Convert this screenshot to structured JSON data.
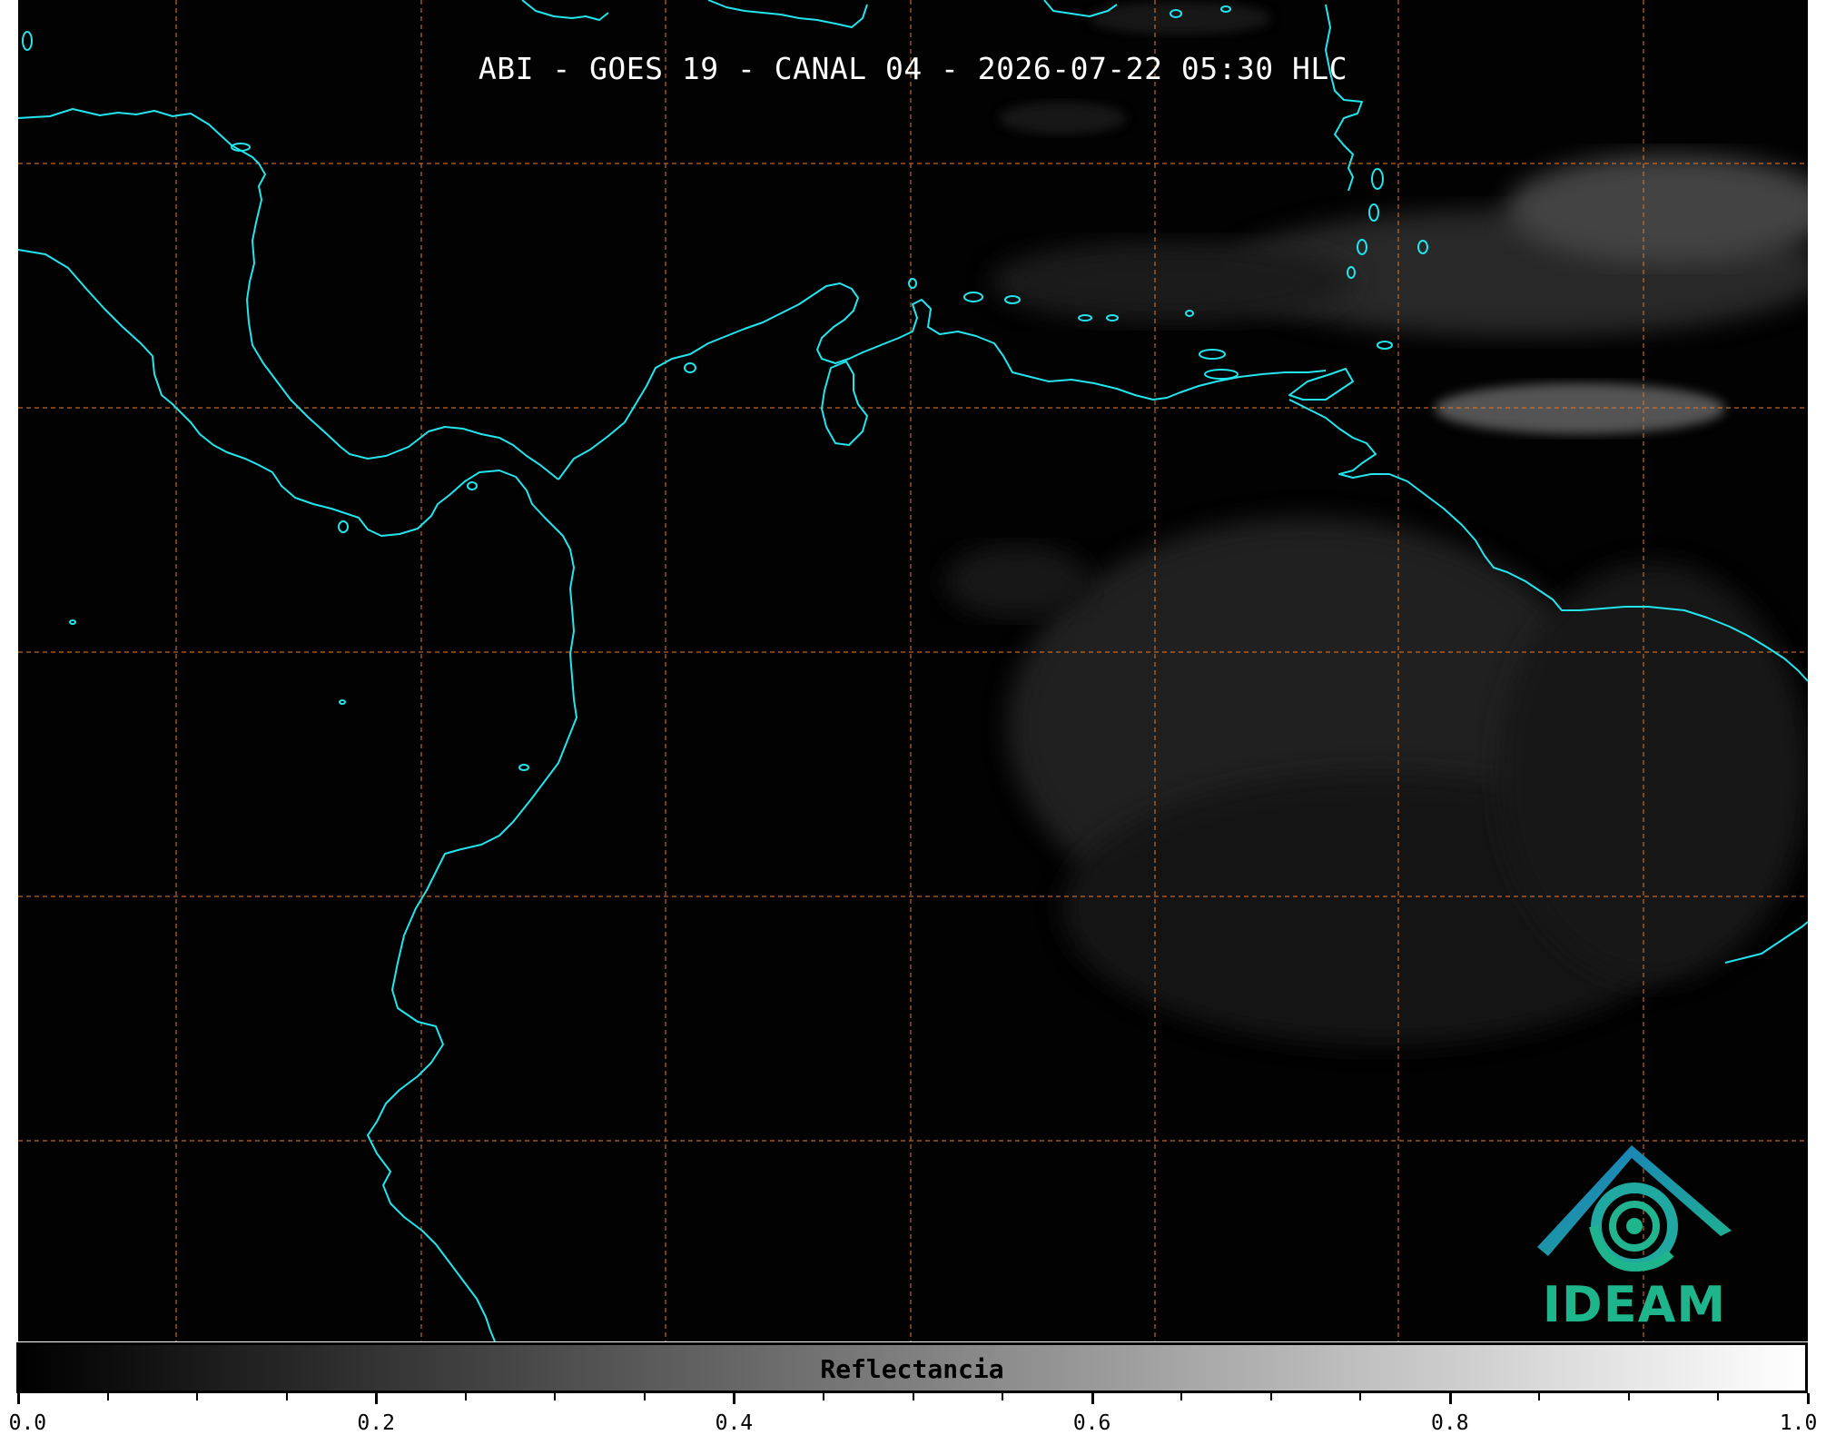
{
  "title": "ABI - GOES 19 - CANAL 04 - 2026-07-22 05:30 HLC",
  "colorbar": {
    "label": "Reflectancia",
    "range": [
      0.0,
      1.0
    ],
    "colormap": "grayscale",
    "major_ticks": [
      "0.0",
      "0.2",
      "0.4",
      "0.6",
      "0.8",
      "1.0"
    ],
    "minor_ticks_per_major": 4
  },
  "map": {
    "background_color": "#020202",
    "coastline_color": "#22e5ee",
    "gridline_color": "#e0782a",
    "gridline_style": "dashed",
    "cloud_color": "#6a6a6a"
  },
  "logo": {
    "text": "IDEAM",
    "icon": "ideam-roof-swirl-icon",
    "roof_color": "#1b76c4",
    "swirl_color": "#1fb58c"
  }
}
